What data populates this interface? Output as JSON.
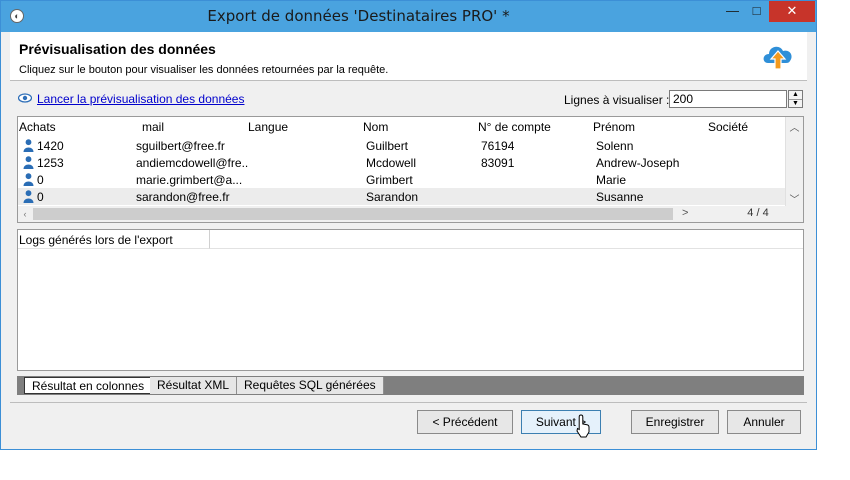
{
  "window": {
    "title": "Export de données 'Destinataires PRO' *",
    "minimize": "—",
    "maximize": "□",
    "close": "✕"
  },
  "header": {
    "title": "Prévisualisation des données",
    "subtitle": "Cliquez sur le bouton pour visualiser les données retournées par la requête.",
    "icon": "cloud-upload-icon"
  },
  "preview": {
    "link_label": "Lancer la prévisualisation des données",
    "lines_label": "Lignes à visualiser :",
    "lines_value": "200"
  },
  "grid": {
    "columns": [
      "Achats",
      "mail",
      "Langue",
      "Nom",
      "N° de compte",
      "Prénom",
      "Société"
    ],
    "rows": [
      {
        "achats": "1420",
        "mail": "sguilbert@free.fr",
        "langue": "",
        "nom": "Guilbert",
        "compte": "76194",
        "prenom": "Solenn",
        "societe": ""
      },
      {
        "achats": "1253",
        "mail": "andiemcdowell@fre..",
        "langue": "",
        "nom": "Mcdowell",
        "compte": "83091",
        "prenom": "Andrew-Joseph",
        "societe": ""
      },
      {
        "achats": "0",
        "mail": "marie.grimbert@a...",
        "langue": "",
        "nom": "Grimbert",
        "compte": "",
        "prenom": "Marie",
        "societe": ""
      },
      {
        "achats": "0",
        "mail": "sarandon@free.fr",
        "langue": "",
        "nom": "Sarandon",
        "compte": "",
        "prenom": "Susanne",
        "societe": ""
      }
    ],
    "row_count": "4 / 4"
  },
  "logs": {
    "header": "Logs générés lors de l'export"
  },
  "tabs": [
    "Résultat en colonnes",
    "Résultat XML",
    "Requêtes SQL générées"
  ],
  "buttons": {
    "previous": "< Précédent",
    "next": "Suivant >",
    "save": "Enregistrer",
    "cancel": "Annuler"
  },
  "colors": {
    "titlebar": "#4aa3df",
    "close": "#c7342a",
    "link": "#0000cc",
    "accent": "#2f8fd8"
  }
}
